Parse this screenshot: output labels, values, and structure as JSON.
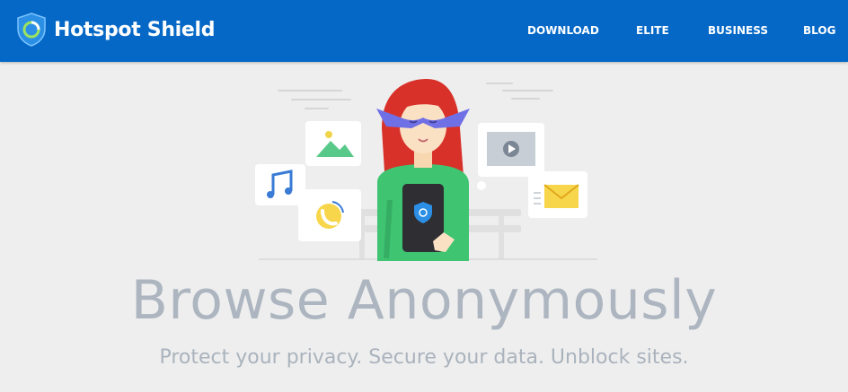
{
  "header": {
    "brand_name": "Hotspot Shield",
    "brand_color": "#0568c6",
    "logo_icon": "shield-logo-icon",
    "nav": [
      {
        "label": "DOWNLOAD"
      },
      {
        "label": "ELITE"
      },
      {
        "label": "BUSINESS"
      },
      {
        "label": "BLOG"
      }
    ]
  },
  "hero": {
    "illustration": "woman-with-mask-and-phone",
    "illustration_icons": [
      "photo-icon",
      "music-icon",
      "phone-call-icon",
      "video-icon",
      "mail-icon"
    ],
    "title": "Browse Anonymously",
    "subtitle": "Protect your privacy. Secure your data. Unblock sites."
  }
}
